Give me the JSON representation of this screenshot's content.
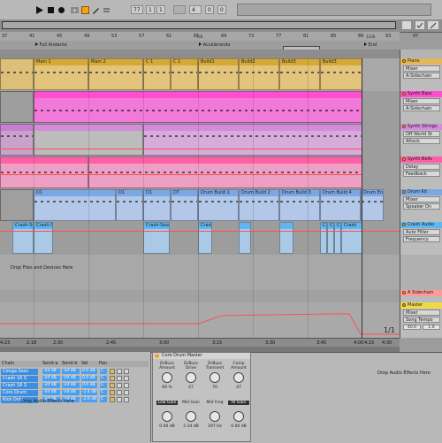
{
  "transport": {
    "tempo_display": "77",
    "position_1": "1",
    "position_2": "1",
    "loop_start": "4",
    "loop_beat_1": "0",
    "loop_beat_2": "0"
  },
  "ruler": {
    "bars": [
      "37",
      "41",
      "45",
      "49",
      "53",
      "57",
      "61",
      "65",
      "69",
      "73",
      "77",
      "81",
      "85",
      "89",
      "93",
      "97"
    ]
  },
  "locators": [
    {
      "label": "Full Andante"
    },
    {
      "label": "Accelerando"
    },
    {
      "label": "End"
    },
    {
      "label": "7/8"
    },
    {
      "label": "12/8"
    }
  ],
  "tracks": [
    {
      "name": "Piano",
      "device": "Mixer",
      "input": "A-Sidechain",
      "color": "#e2b85a",
      "clips": [
        "Main 1",
        "Main 2",
        "C 1",
        "C 1",
        "Build1",
        "Build2",
        "Build3",
        "Build3"
      ]
    },
    {
      "name": "Synth Bass",
      "device": "Mixer",
      "input": "A-Sidechain",
      "color": "#ff4fd0",
      "clips": []
    },
    {
      "name": "Synth Strings",
      "device": "Off World St",
      "input": "Attack",
      "color": "#d48bdc",
      "clips": []
    },
    {
      "name": "Synth Bells",
      "device": "Delay",
      "input": "Feedback",
      "color": "#ff5ea8",
      "clips": []
    },
    {
      "name": "Drum Kit",
      "device": "Mixer",
      "input": "Speaker On",
      "color": "#7aa8e6",
      "clips": [
        "D1",
        "D1",
        "D1",
        "DT",
        "Drum Build 1",
        "Drum Build 2",
        "Drum Build 3",
        "Drum Build 4",
        "Drum End"
      ]
    },
    {
      "name": "Crash Audio",
      "device": "Auto Filter",
      "input": "Frequency",
      "color": "#5fb6f0",
      "clips": [
        "Crash-Sa",
        "Crash-S",
        "Crash-Sess",
        "Crash",
        "Cr",
        "Cr",
        "Cr",
        "Crash",
        "Crash"
      ]
    },
    {
      "name": "A Sidechain",
      "device": "",
      "input": "",
      "color": "#ff9a9a",
      "clips": []
    },
    {
      "name": "Master",
      "device": "Mixer",
      "input": "Song Tempo",
      "color": "#f0d84a",
      "clips": []
    }
  ],
  "drop_zone": {
    "label": "Drop Files and Devices Here"
  },
  "master_values": {
    "left": "40.0",
    "right": "1.0"
  },
  "meter_text": "1/1",
  "timeline": {
    "marks": [
      "2:18",
      "2:30",
      "2:45",
      "3:00",
      "3:15",
      "3:30",
      "3:45",
      "4:00",
      "4:15",
      "4:23"
    ],
    "end_label": "4:30"
  },
  "chain": {
    "header": [
      "Chain",
      "Send-a",
      "Send-b",
      "Vel",
      "Pan"
    ],
    "rows": [
      {
        "name": "Conga Sess",
        "send_a": "-inf dB",
        "send_b": "-inf dB",
        "vel": "0.0 dB",
        "pan": "C"
      },
      {
        "name": "Crash 16 S",
        "send_a": "-inf dB",
        "send_b": "-inf dB",
        "vel": "0.0 dB",
        "pan": "C"
      },
      {
        "name": "Crash 16 S",
        "send_a": "-inf dB",
        "send_b": "-inf dB",
        "vel": "0.0 dB",
        "pan": "C"
      },
      {
        "name": "Core Drum",
        "send_a": "-inf dB",
        "send_b": "-inf dB",
        "vel": "-2.4 dB",
        "pan": "C"
      },
      {
        "name": "Kick Only",
        "send_a": "-inf dB",
        "send_b": "-inf dB",
        "vel": "-2.0 dB",
        "pan": "C"
      }
    ],
    "drop_label": "Drop Audio Effects Here"
  },
  "rack": {
    "title": "Core Drum Master",
    "knobs_top": [
      {
        "label": "DrBuss Amount",
        "value": "69 %"
      },
      {
        "label": "DrBuss Drive",
        "value": "47"
      },
      {
        "label": "DrBuss Transient",
        "value": "70"
      },
      {
        "label": "Comp Amount",
        "value": "47"
      }
    ],
    "knobs_bottom": [
      {
        "label": "Low Gain",
        "value": "0.00 dB"
      },
      {
        "label": "Mid Gain",
        "value": "2.34 dB"
      },
      {
        "label": "Mid Freq",
        "value": "297 Hz"
      },
      {
        "label": "Hi Gain",
        "value": "0.00 dB"
      }
    ]
  },
  "right_drop_label": "Drop Audio Effects Here"
}
